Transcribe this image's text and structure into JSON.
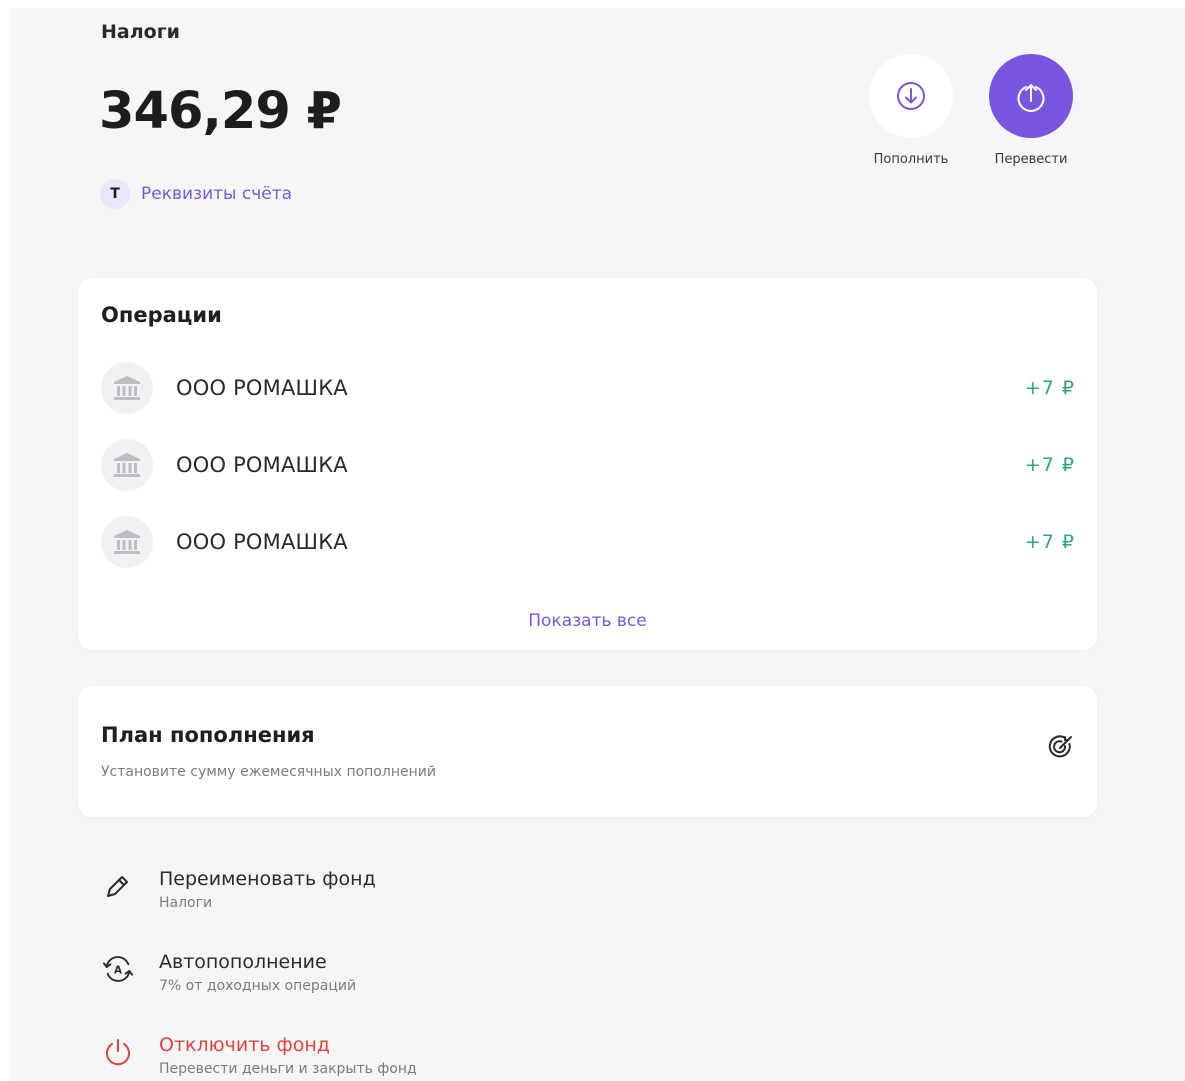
{
  "fund": {
    "title": "Налоги",
    "balance": "346,29 ₽",
    "requisites_badge": "T",
    "requisites_label": "Реквизиты счёта"
  },
  "actions": {
    "topup_label": "Пополнить",
    "transfer_label": "Перевести"
  },
  "operations": {
    "title": "Операции",
    "items": [
      {
        "name": "ООО РОМАШКА",
        "amount": "+7 ₽",
        "icon": "bank-icon"
      },
      {
        "name": "ООО РОМАШКА",
        "amount": "+7 ₽",
        "icon": "bank-icon"
      },
      {
        "name": "ООО РОМАШКА",
        "amount": "+7 ₽",
        "icon": "bank-icon"
      }
    ],
    "show_all_label": "Показать все"
  },
  "plan": {
    "title": "План пополнения",
    "subtitle": "Установите сумму ежемесячных пополнений",
    "icon": "target-icon"
  },
  "settings": {
    "rename": {
      "title": "Переименовать фонд",
      "subtitle": "Налоги",
      "icon": "pencil-icon"
    },
    "autotopup": {
      "title": "Автопополнение",
      "subtitle": "7% от доходных операций",
      "icon": "autotopup-icon"
    },
    "disable": {
      "title": "Отключить фонд",
      "subtitle": "Перевести деньги и закрыть фонд",
      "icon": "power-icon"
    }
  },
  "colors": {
    "accent": "#7a56e0",
    "income": "#2fa383",
    "danger": "#e0443f",
    "background": "#f6f6f7"
  }
}
